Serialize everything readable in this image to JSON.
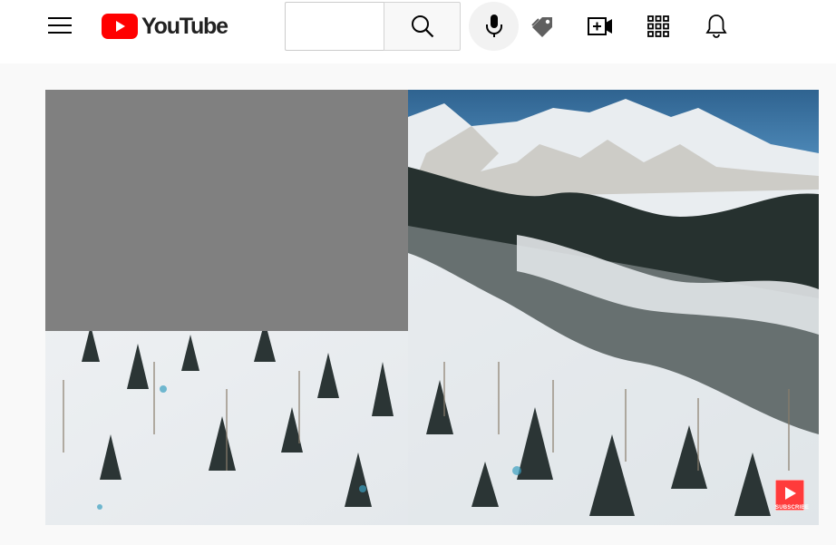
{
  "masthead": {
    "logo_text": "YouTube",
    "search": {
      "query": "",
      "placeholder": ""
    },
    "icons": {
      "menu": "hamburger-menu-icon",
      "search": "search-icon",
      "voice": "microphone-icon",
      "tag": "tag-icon",
      "create": "video-add-icon",
      "apps": "apps-grid-icon",
      "notifications": "bell-icon"
    }
  },
  "player": {
    "watermark_text": "SUBSCRIBE",
    "thumbnail_placeholder": "gray-block"
  },
  "colors": {
    "brand_red": "#ff0000",
    "sky": "#3a6fa0",
    "snow": "#eef1f3",
    "forest": "#1f2a2a",
    "placeholder_gray": "#808080"
  }
}
